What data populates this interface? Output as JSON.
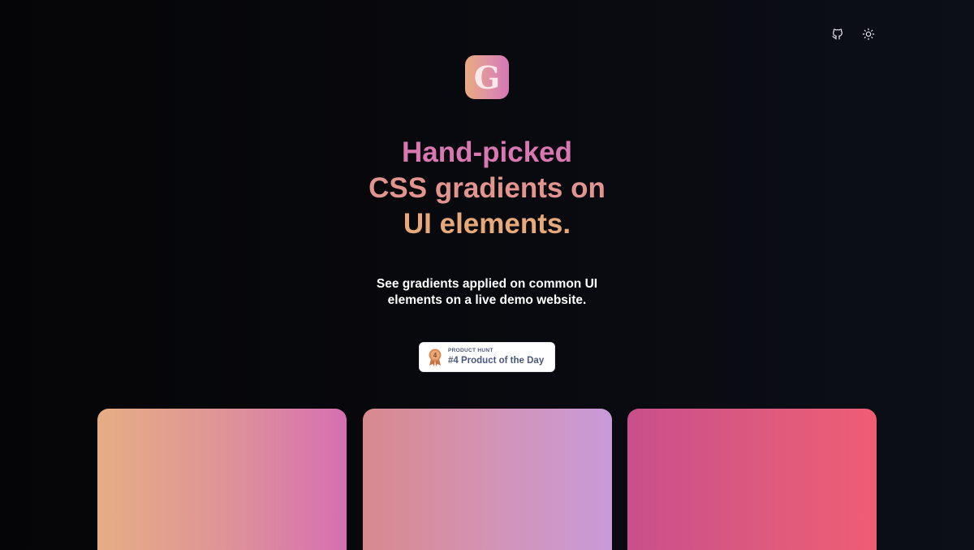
{
  "header": {
    "icons": [
      "github-icon",
      "sun-icon"
    ]
  },
  "logo": {
    "letter": "G"
  },
  "hero": {
    "headline_line1": "Hand-picked",
    "headline_line2": "CSS gradients on",
    "headline_line3": "UI elements.",
    "subtitle_line1": "See gradients applied on common UI",
    "subtitle_line2": "elements on a live demo website."
  },
  "badge": {
    "kicker": "PRODUCT HUNT",
    "title": "#4 Product of the Day",
    "medal_number": "4"
  },
  "colors": {
    "background": "#07080c",
    "card1": [
      "#e6ad84",
      "#d66fb2"
    ],
    "card2": [
      "#d9898d",
      "#c99ad9"
    ],
    "card3": [
      "#c94f8c",
      "#ef5d74"
    ]
  }
}
